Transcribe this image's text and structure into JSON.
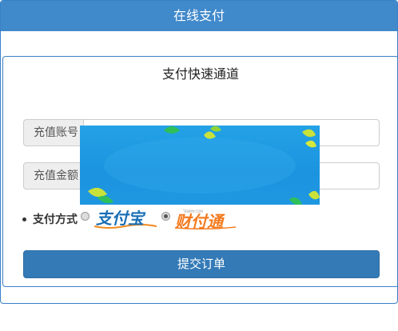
{
  "header": {
    "title": "在线支付"
  },
  "panel": {
    "title": "支付快速通道"
  },
  "form": {
    "account": {
      "label": "充值账号",
      "value": "",
      "placeholder": ""
    },
    "amount": {
      "label": "充值金额",
      "value": "",
      "placeholder": ""
    },
    "payment_method": {
      "label": "支付方式",
      "options": [
        {
          "name": "alipay",
          "logo_text": "支付宝",
          "checked": false
        },
        {
          "name": "tenpay",
          "logo_text": "财付通",
          "logo_small_text": "TENPAY.COM",
          "checked": true
        }
      ]
    },
    "submit_label": "提交订单"
  },
  "colors": {
    "header_bg": "#4089cb",
    "button_bg": "#337ab7",
    "banner_bg": "#1f97e0",
    "alipay_orange": "#f08b1e",
    "tenpay_orange": "#f47b20"
  }
}
